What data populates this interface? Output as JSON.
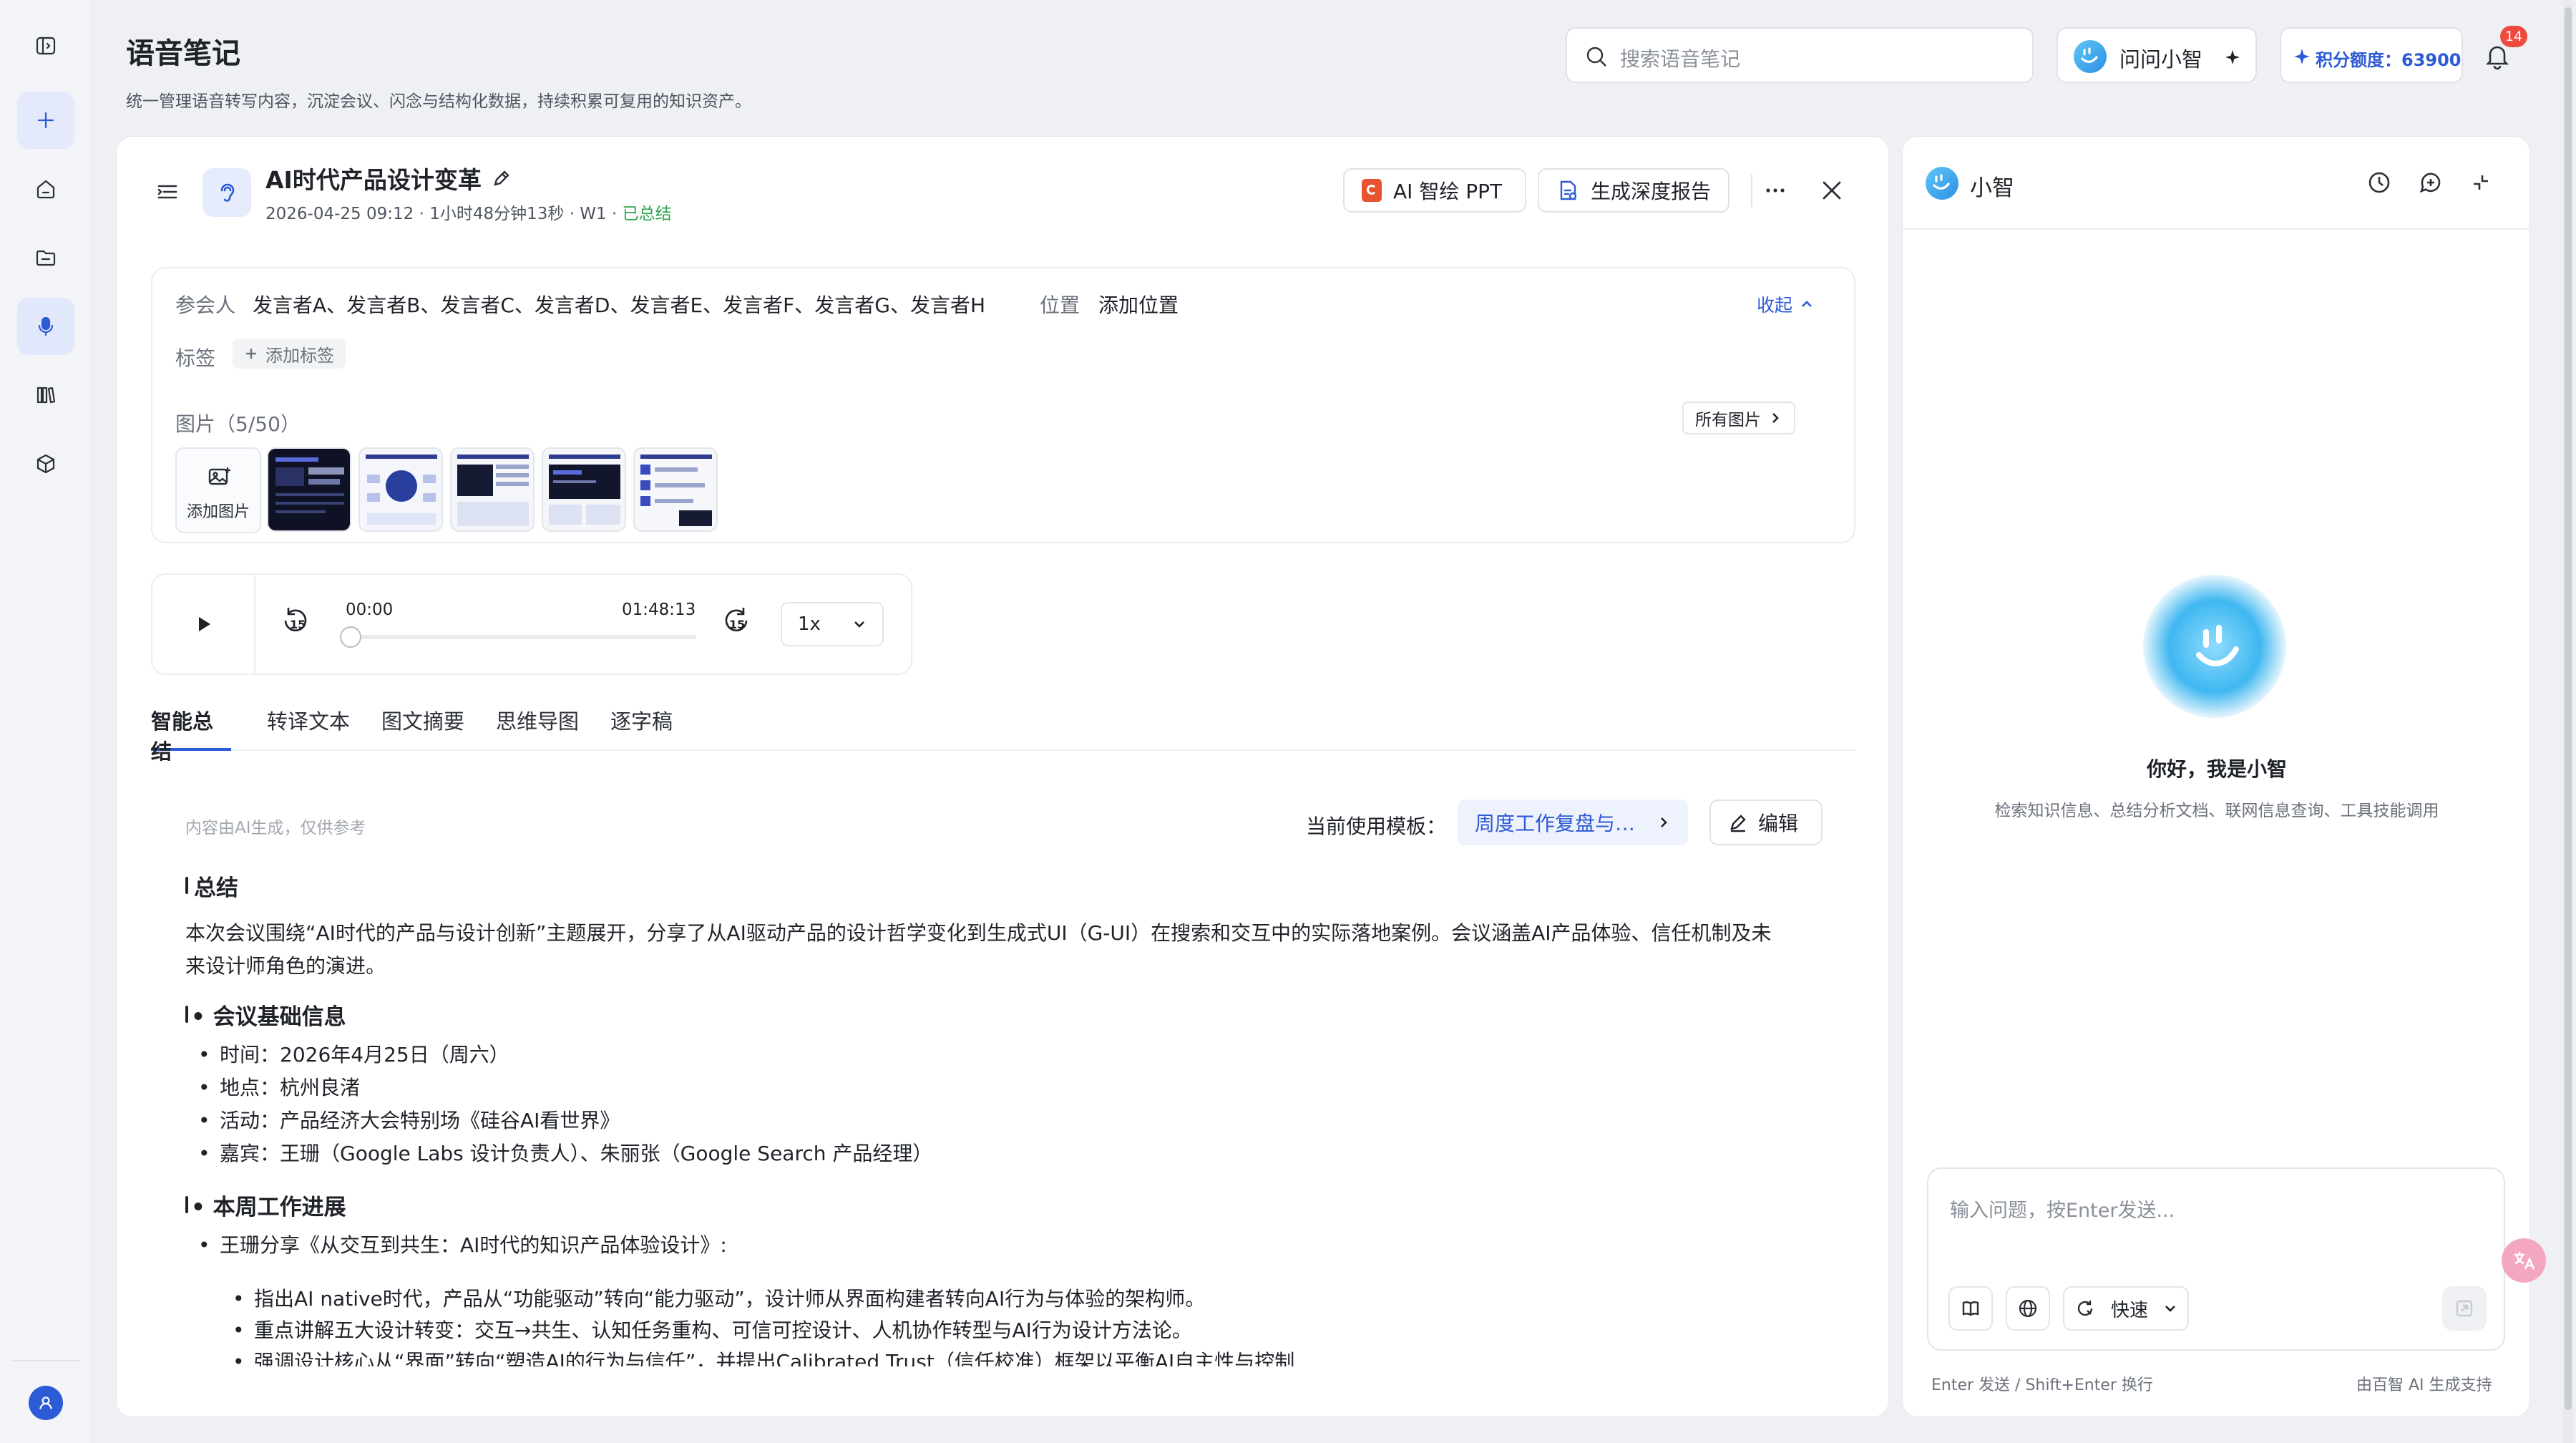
{
  "header": {
    "title": "语音笔记",
    "subtitle": "统一管理语音转写内容，沉淀会议、闪念与结构化数据，持续积累可复用的知识资产。",
    "search_placeholder": "搜索语音笔记",
    "ask_label": "问问小智",
    "credits_label": "积分额度：63900",
    "notification_count": "14"
  },
  "sidebar": {
    "items": [
      "panel-toggle",
      "new",
      "home",
      "folder",
      "voice-notes",
      "library",
      "package"
    ],
    "active": "voice-notes"
  },
  "note": {
    "title": "AI时代产品设计变革",
    "meta": "2026-04-25 09:12 · 1小时48分钟13秒 · W1 · ",
    "status": "已总结",
    "ppt_label": "AI 智绘 PPT",
    "report_label": "生成深度报告"
  },
  "info": {
    "participants_label": "参会人",
    "participants": "发言者A、发言者B、发言者C、发言者D、发言者E、发言者F、发言者G、发言者H",
    "location_label": "位置",
    "location_value": "添加位置",
    "collapse_label": "收起",
    "tags_label": "标签",
    "add_tag_label": "添加标签",
    "images_label": "图片（5/50）",
    "all_images_label": "所有图片",
    "add_image_label": "添加图片"
  },
  "player": {
    "current_time": "00:00",
    "total_time": "01:48:13",
    "progress": 0,
    "rewind_label": "15",
    "forward_label": "15",
    "speed": "1x"
  },
  "tabs": [
    "智能总结",
    "转译文本",
    "图文摘要",
    "思维导图",
    "逐字稿"
  ],
  "active_tab": "智能总结",
  "summary": {
    "disclaimer": "内容由AI生成，仅供参考",
    "template_label": "当前使用模板：",
    "template_value": "周度工作复盘与…",
    "edit_label": "编辑",
    "section1_title": "总结",
    "section1_text": "本次会议围绕“AI时代的产品与设计创新”主题展开，分享了从AI驱动产品的设计哲学变化到生成式UI（G-UI）在搜索和交互中的实际落地案例。会议涵盖AI产品体验、信任机制及未来设计师角色的演进。",
    "section2_title": "• 会议基础信息",
    "section2_items": [
      "时间：2026年4月25日（周六）",
      "地点：杭州良渚",
      "活动：产品经济大会特别场《硅谷AI看世界》",
      "嘉宾：王珊（Google Labs 设计负责人）、朱丽张（Google Search 产品经理）"
    ],
    "section3_title": "• 本周工作进展",
    "section3_item": "王珊分享《从交互到共生：AI时代的知识产品体验设计》:",
    "section3_subitems": [
      "指出AI native时代，产品从“功能驱动”转向“能力驱动”，设计师从界面构建者转向AI行为与体验的架构师。",
      "重点讲解五大设计转变：交互→共生、认知任务重构、可信可控设计、人机协作转型与AI行为设计方法论。",
      "强调设计核心从“界面”转向“塑造AI的行为与信任”，并提出Calibrated Trust（信任校准）框架以平衡AI自主性与控制"
    ]
  },
  "assistant": {
    "name": "小智",
    "greeting": "你好，我是小智",
    "capabilities": "检索知识信息、总结分析文档、联网信息查询、工具技能调用",
    "input_placeholder": "输入问题，按Enter发送...",
    "mode_label": "快速",
    "hint_left": "Enter 发送 / Shift+Enter 换行",
    "hint_right": "由百智 AI 生成支持"
  },
  "colors": {
    "accent": "#2d5bd6",
    "success": "#2ea44f",
    "badge": "#f04a3e",
    "assistant_glow": "#3fb7f0"
  }
}
